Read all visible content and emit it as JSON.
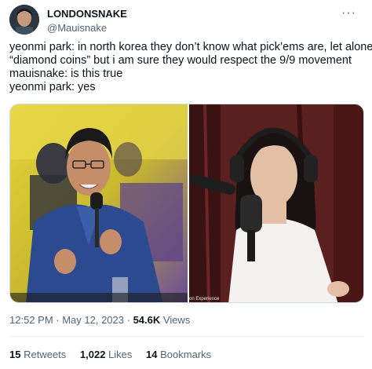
{
  "user": {
    "display_name": "LONDONSNAKE",
    "handle": "@Mauisnake"
  },
  "tweet": {
    "lines": [
      "yeonmi park: in north korea they don’t know what pick’ems are, let alone",
      "“diamond coins” but i am sure they would respect the 9/9 movement",
      "mauisnake: is this true",
      "yeonmi park: yes"
    ]
  },
  "media": {
    "right_caption": "on Experience"
  },
  "meta": {
    "time": "12:52 PM",
    "sep1": " · ",
    "date": "May 12, 2023",
    "sep2": " · ",
    "views_count": "54.6K",
    "views_label": " Views"
  },
  "stats": {
    "retweets_count": "15",
    "retweets_label": " Retweets",
    "likes_count": "1,022",
    "likes_label": " Likes",
    "bookmarks_count": "14",
    "bookmarks_label": " Bookmarks"
  },
  "icons": {
    "more": "more-icon",
    "avatar": "avatar"
  }
}
